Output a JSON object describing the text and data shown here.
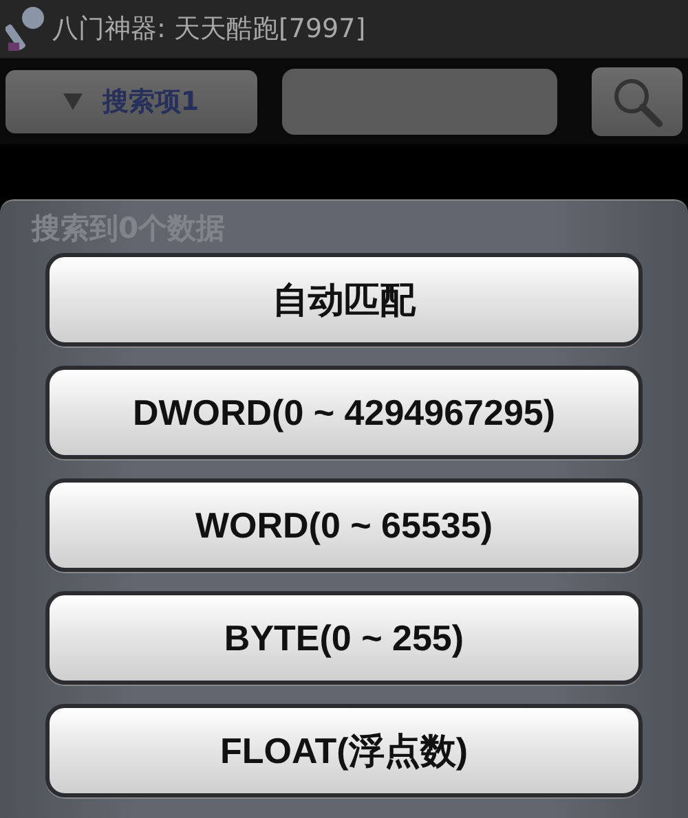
{
  "window": {
    "title": "八门神器: 天天酷跑[7997]"
  },
  "search_bar": {
    "dropdown": "搜索项1"
  },
  "results_text": "搜索到0个数据",
  "type_menu": {
    "options": [
      {
        "label": "自动匹配"
      },
      {
        "label": "DWORD(0 ~ 4294967295)"
      },
      {
        "label": "WORD(0 ~ 65535)"
      },
      {
        "label": "BYTE(0 ~ 255)"
      },
      {
        "label": "FLOAT(浮点数)"
      }
    ]
  }
}
